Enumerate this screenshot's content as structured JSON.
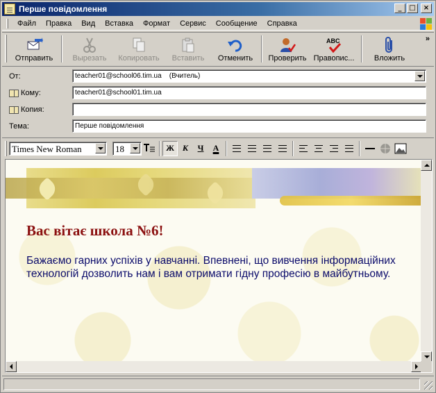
{
  "window": {
    "title": "Перше повідомлення"
  },
  "menu": [
    "Файл",
    "Правка",
    "Вид",
    "Вставка",
    "Формат",
    "Сервис",
    "Сообщение",
    "Справка"
  ],
  "toolbar": {
    "send": "Отправить",
    "cut": "Вырезать",
    "copy": "Копировать",
    "paste": "Вставить",
    "undo": "Отменить",
    "check": "Проверить",
    "spelling": "Правопис...",
    "attach": "Вложить",
    "more": "»"
  },
  "header": {
    "from_label": "От:",
    "from_value": "teacher01@school06.tim.ua    (Вчитель)",
    "to_label": "Кому:",
    "to_value": "teacher01@school01.tim.ua",
    "cc_label": "Копия:",
    "cc_value": "",
    "subject_label": "Тема:",
    "subject_value": "Перше повідомлення"
  },
  "format": {
    "font": "Times New Roman",
    "size": "18",
    "bold": "Ж",
    "italic": "К",
    "underline": "Ч",
    "font_color": "А"
  },
  "message": {
    "greeting": "Вас вітає школа №6!",
    "body": "Бажаємо гарних успіхів у навчанні. Впевнені, що вивчення інформаційних технологій дозволить нам і вам отримати гідну професію в майбутньому."
  },
  "colors": {
    "greeting": "#8b1010",
    "body_text": "#0b0b6b",
    "titlebar": "#0a246a"
  }
}
